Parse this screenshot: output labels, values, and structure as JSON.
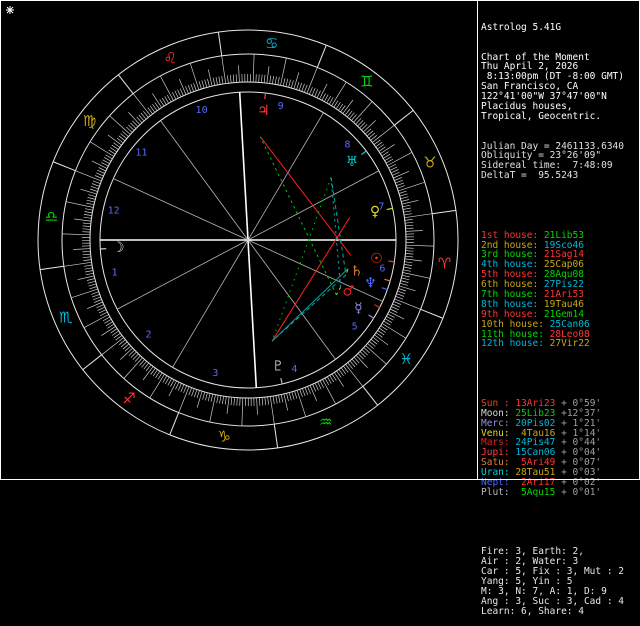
{
  "app": {
    "title": "Astrolog 5.41G"
  },
  "sidebar": {
    "title": "Astrolog 5.41G",
    "header_lines": [
      "Chart of the Moment",
      "Thu April 2, 2026",
      " 8:13:00pm (DT -8:00 GMT)",
      "San Francisco, CA",
      "122°41'00\"W 37°47'00\"N",
      "Placidus houses,",
      "Tropical, Geocentric."
    ],
    "calc_lines": [
      "Julian Day = 2461133.6340",
      "Obliquity = 23°26'09\"",
      "Sidereal time:  7:48:09",
      "DeltaT =  95.5243"
    ],
    "summary_lines": [
      "Fire: 3, Earth: 2,",
      "Air : 2, Water: 3",
      "Car : 5, Fix : 3, Mut : 2",
      "Yang: 5, Yin : 5",
      "M: 3, N: 7, A: 1, D: 9",
      "Ang : 3, Suc : 3, Cad : 4",
      "Learn: 6, Share: 4"
    ]
  },
  "colors": {
    "fire": "#ff3434",
    "earth": "#c8a818",
    "air": "#00d800",
    "water": "#00b8d8",
    "velocity": "#a0a0a0",
    "house_number": "#5868ff",
    "ring": "#e8e8e8",
    "text": "#e8e8e8",
    "aspect_conjunction": "#d8d800",
    "aspect_square": "#ff2020",
    "aspect_trine": "#00c800",
    "aspect_sextile": "#00a8a8"
  },
  "chart_data": {
    "type": "astrology-wheel",
    "ascendant_lon": 201.883,
    "signs": [
      {
        "name": "aries",
        "glyph": "♈",
        "element": "fire"
      },
      {
        "name": "taurus",
        "glyph": "♉",
        "element": "earth"
      },
      {
        "name": "gemini",
        "glyph": "♊",
        "element": "air"
      },
      {
        "name": "cancer",
        "glyph": "♋",
        "element": "water"
      },
      {
        "name": "leo",
        "glyph": "♌",
        "element": "fire"
      },
      {
        "name": "virgo",
        "glyph": "♍",
        "element": "earth"
      },
      {
        "name": "libra",
        "glyph": "♎",
        "element": "air"
      },
      {
        "name": "scorpio",
        "glyph": "♏",
        "element": "water"
      },
      {
        "name": "sagittarius",
        "glyph": "♐",
        "element": "fire"
      },
      {
        "name": "capricorn",
        "glyph": "♑",
        "element": "earth"
      },
      {
        "name": "aquarius",
        "glyph": "♒",
        "element": "air"
      },
      {
        "name": "pisces",
        "glyph": "♓",
        "element": "water"
      }
    ],
    "houses": [
      {
        "label": "1st house:",
        "value": "21Lib53",
        "lon": 201.883,
        "house_element": "fire",
        "sign_element": "air"
      },
      {
        "label": "2nd house:",
        "value": "19Sco46",
        "lon": 229.767,
        "house_element": "earth",
        "sign_element": "water"
      },
      {
        "label": "3rd house:",
        "value": "21Sag14",
        "lon": 261.233,
        "house_element": "air",
        "sign_element": "fire"
      },
      {
        "label": "4th house:",
        "value": "25Cap06",
        "lon": 295.1,
        "house_element": "water",
        "sign_element": "earth"
      },
      {
        "label": "5th house:",
        "value": "28Aqu08",
        "lon": 328.133,
        "house_element": "fire",
        "sign_element": "air"
      },
      {
        "label": "6th house:",
        "value": "27Pis22",
        "lon": 357.367,
        "house_element": "earth",
        "sign_element": "water"
      },
      {
        "label": "7th house:",
        "value": "21Ari53",
        "lon": 21.883,
        "house_element": "air",
        "sign_element": "fire"
      },
      {
        "label": "8th house:",
        "value": "19Tau46",
        "lon": 49.767,
        "house_element": "water",
        "sign_element": "earth"
      },
      {
        "label": "9th house:",
        "value": "21Gem14",
        "lon": 81.233,
        "house_element": "fire",
        "sign_element": "air"
      },
      {
        "label": "10th house:",
        "value": "25Can06",
        "lon": 115.1,
        "house_element": "earth",
        "sign_element": "water"
      },
      {
        "label": "11th house:",
        "value": "28Leo08",
        "lon": 148.133,
        "house_element": "air",
        "sign_element": "fire"
      },
      {
        "label": "12th house:",
        "value": "27Vir22",
        "lon": 177.367,
        "house_element": "water",
        "sign_element": "earth"
      }
    ],
    "planets": [
      {
        "name": "sun",
        "label": "Sun :",
        "glyph": "☉",
        "value": "13Ari23",
        "lon": 13.383,
        "velocity": "+ 0°59'",
        "sign_element": "fire",
        "color": "#ff4010"
      },
      {
        "name": "moon",
        "label": "Moon:",
        "glyph": "☽",
        "value": "25Lib23",
        "lon": 205.383,
        "velocity": "+12°37'",
        "sign_element": "air",
        "color": "#d8d8d8"
      },
      {
        "name": "mercury",
        "label": "Merc:",
        "glyph": "☿",
        "value": "20Pis02",
        "lon": 350.033,
        "velocity": "+ 1°21'",
        "sign_element": "water",
        "color": "#9090e8"
      },
      {
        "name": "venus",
        "label": "Venu:",
        "glyph": "♀",
        "value": " 4Tau16",
        "lon": 34.267,
        "velocity": "+ 1°14'",
        "sign_element": "earth",
        "color": "#d8d820"
      },
      {
        "name": "mars",
        "label": "Mars:",
        "glyph": "♂",
        "value": "24Pis47",
        "lon": 354.783,
        "velocity": "+ 0°44'",
        "sign_element": "water",
        "color": "#e02020"
      },
      {
        "name": "jupiter",
        "label": "Jupi:",
        "glyph": "♃",
        "value": "15Can06",
        "lon": 105.1,
        "velocity": "+ 0°04'",
        "sign_element": "water",
        "color": "#ff4040"
      },
      {
        "name": "saturn",
        "label": "Satu:",
        "glyph": "♄",
        "value": " 5Ari49",
        "lon": 5.817,
        "velocity": "+ 0°07'",
        "sign_element": "fire",
        "color": "#e08030"
      },
      {
        "name": "uranus",
        "label": "Uran:",
        "glyph": "♅",
        "value": "28Tau51",
        "lon": 58.85,
        "velocity": "+ 0°03'",
        "sign_element": "earth",
        "color": "#00d0d0"
      },
      {
        "name": "neptune",
        "label": "Nept:",
        "glyph": "♆",
        "value": " 2Ari17",
        "lon": 2.283,
        "velocity": "+ 0°02'",
        "sign_element": "fire",
        "color": "#4868ff"
      },
      {
        "name": "pluto",
        "label": "Plut:",
        "glyph": "♇",
        "value": " 5Aqu15",
        "lon": 305.25,
        "velocity": "+ 0°01'",
        "sign_element": "air",
        "color": "#b8b8b8"
      }
    ],
    "aspects": [
      {
        "a": "mercury",
        "b": "mars",
        "type": "conjunction",
        "orb": 4.8
      },
      {
        "a": "saturn",
        "b": "neptune",
        "type": "conjunction",
        "orb": 3.5
      },
      {
        "a": "sun",
        "b": "jupiter",
        "type": "square",
        "orb": 1.7
      },
      {
        "a": "venus",
        "b": "pluto",
        "type": "square",
        "orb": 1.0
      },
      {
        "a": "mercury",
        "b": "jupiter",
        "type": "trine",
        "orb": 5.1
      },
      {
        "a": "uranus",
        "b": "pluto",
        "type": "trine",
        "orb": 6.4
      },
      {
        "a": "mars",
        "b": "uranus",
        "type": "sextile",
        "orb": 4.1
      },
      {
        "a": "saturn",
        "b": "pluto",
        "type": "sextile",
        "orb": 0.6
      },
      {
        "a": "uranus",
        "b": "neptune",
        "type": "sextile",
        "orb": 3.4
      },
      {
        "a": "neptune",
        "b": "pluto",
        "type": "sextile",
        "orb": 3.0
      }
    ]
  }
}
